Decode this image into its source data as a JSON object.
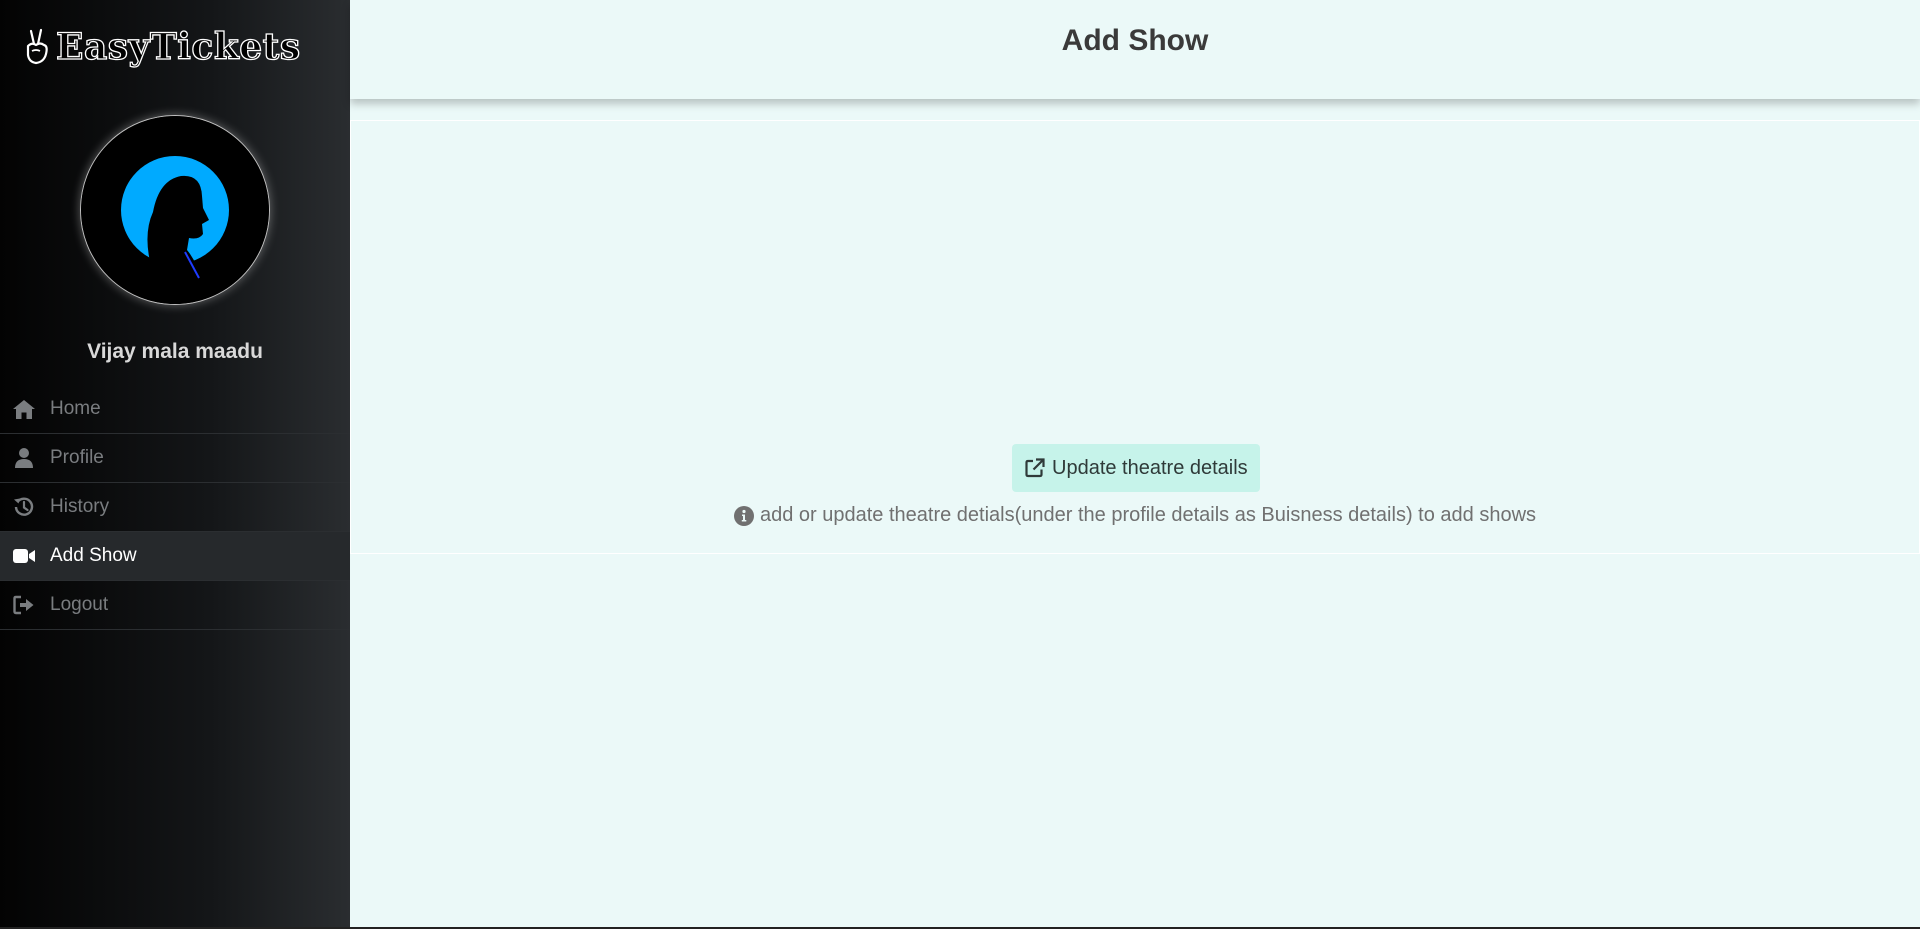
{
  "brand": {
    "name": "EasyTickets",
    "icon": "hand-peace-icon"
  },
  "user": {
    "name": "Vijay mala maadu",
    "avatar_icon": "user-silhouette-avatar"
  },
  "sidebar": {
    "items": [
      {
        "label": "Home",
        "icon": "home-icon",
        "active": false
      },
      {
        "label": "Profile",
        "icon": "user-icon",
        "active": false
      },
      {
        "label": "History",
        "icon": "history-icon",
        "active": false
      },
      {
        "label": "Add Show",
        "icon": "video-camera-icon",
        "active": true
      },
      {
        "label": "Logout",
        "icon": "sign-out-icon",
        "active": false
      }
    ]
  },
  "header": {
    "title": "Add Show"
  },
  "main": {
    "update_button_label": "Update theatre details",
    "update_button_icon": "external-link-icon",
    "info_text": "add or update theatre detials(under the profile details as Buisness details) to add shows",
    "info_icon": "info-circle-icon"
  },
  "colors": {
    "sidebar_dark": "#030303",
    "main_bg": "#ebf9f8",
    "button_bg": "#c6f3ea",
    "avatar_accent": "#00aaff"
  }
}
